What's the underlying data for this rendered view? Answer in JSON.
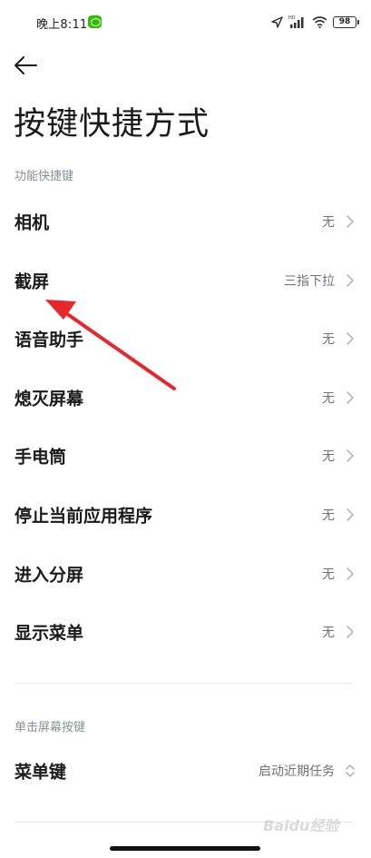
{
  "status_bar": {
    "time": "晚上8:11",
    "battery": "98",
    "icons": [
      "wechat-icon",
      "location-icon",
      "hd-signal-icon",
      "wifi-icon",
      "battery-icon"
    ]
  },
  "header": {
    "back_icon": "arrow-left-icon",
    "title": "按键快捷方式"
  },
  "sections": [
    {
      "title": "功能快捷键",
      "items": [
        {
          "label": "相机",
          "value": "无"
        },
        {
          "label": "截屏",
          "value": "三指下拉"
        },
        {
          "label": "语音助手",
          "value": "无"
        },
        {
          "label": "熄灭屏幕",
          "value": "无"
        },
        {
          "label": "手电筒",
          "value": "无"
        },
        {
          "label": "停止当前应用程序",
          "value": "无"
        },
        {
          "label": "进入分屏",
          "value": "无"
        },
        {
          "label": "显示菜单",
          "value": "无"
        }
      ]
    },
    {
      "title": "单击屏幕按键",
      "items": [
        {
          "label": "菜单键",
          "value": "启动近期任务"
        }
      ]
    }
  ],
  "annotation": {
    "color": "#e8262b"
  },
  "colors": {
    "text": "#1a1a1a",
    "secondary": "#8a8f99",
    "value": "#6f7278"
  },
  "watermark": "Baidu经验"
}
